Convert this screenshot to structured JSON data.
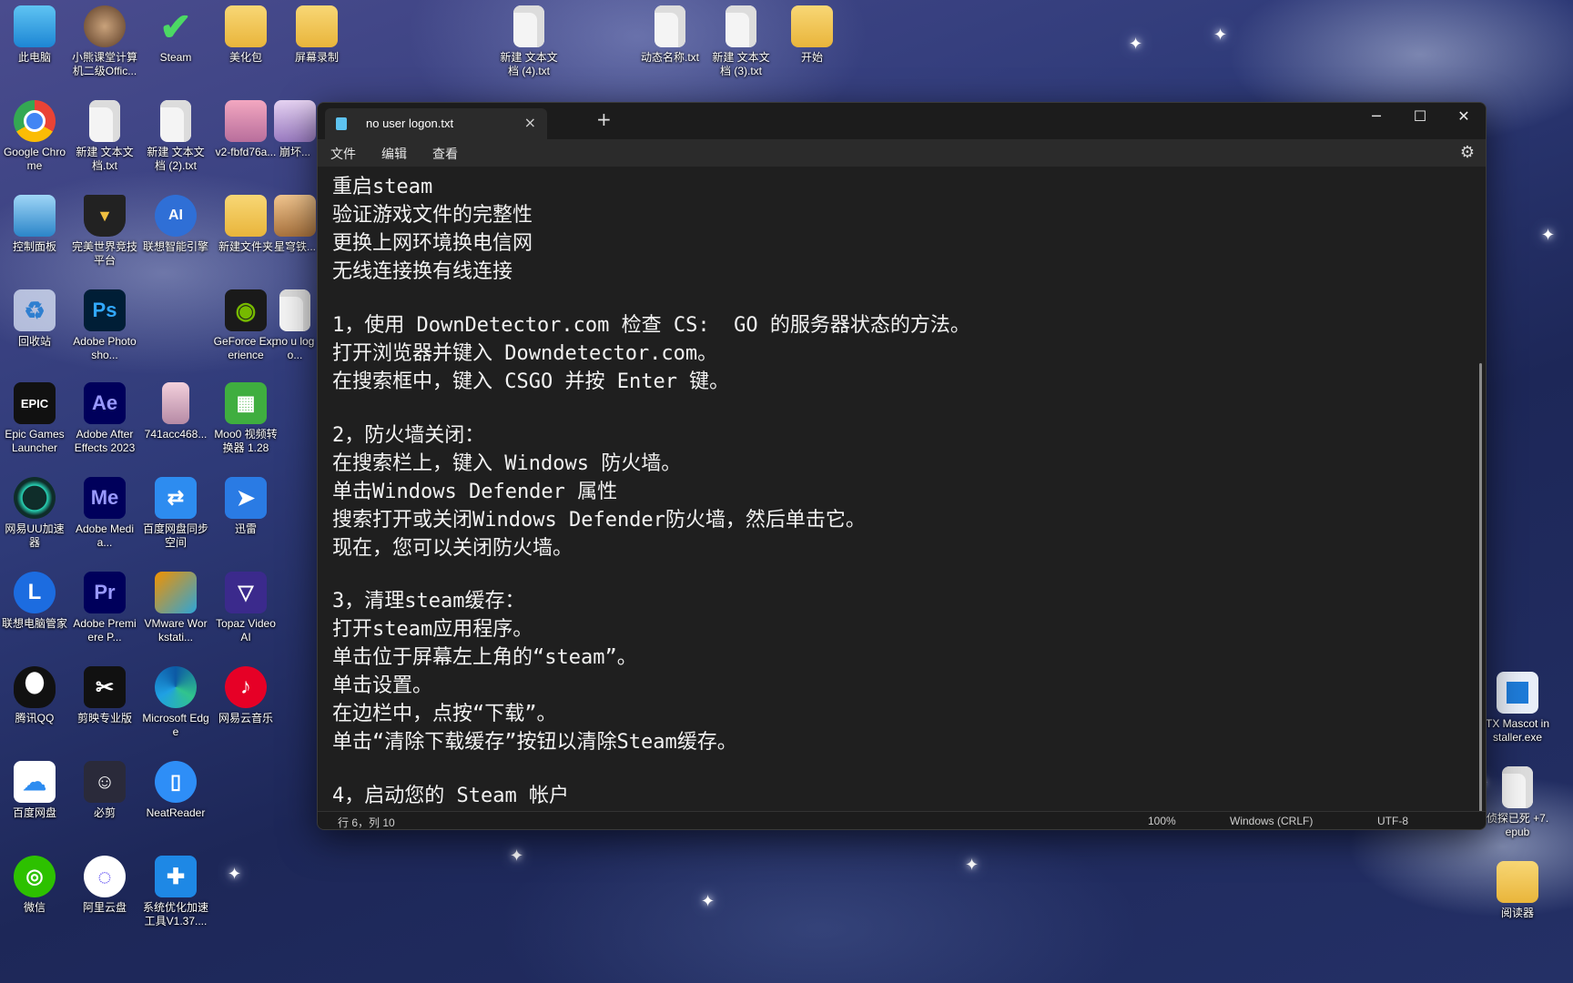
{
  "desktop_icons": [
    {
      "label": "此电脑"
    },
    {
      "label": "小熊课堂计算机二级Offic..."
    },
    {
      "label": "Steam"
    },
    {
      "label": "美化包"
    },
    {
      "label": "屏幕录制"
    },
    {
      "label": "新建 文本文档 (4).txt"
    },
    {
      "label": "动态名称.txt"
    },
    {
      "label": "新建 文本文档 (3).txt"
    },
    {
      "label": "开始"
    },
    {
      "label": "Google Chrome"
    },
    {
      "label": "新建 文本文档.txt"
    },
    {
      "label": "新建 文本文档 (2).txt"
    },
    {
      "label": "v2-fbfd76a..."
    },
    {
      "label": "崩坏..."
    },
    {
      "label": "控制面板"
    },
    {
      "label": "完美世界竞技平台"
    },
    {
      "label": "联想智能引擎"
    },
    {
      "label": "新建文件夹"
    },
    {
      "label": "星穹铁..."
    },
    {
      "label": "回收站"
    },
    {
      "label": "Adobe Photosho..."
    },
    {
      "label": "GeForce Experience"
    },
    {
      "label": "no u logo..."
    },
    {
      "label": "Epic Games Launcher"
    },
    {
      "label": "Adobe After Effects 2023"
    },
    {
      "label": "741acc468..."
    },
    {
      "label": "Moo0 视频转换器 1.28"
    },
    {
      "label": "网易UU加速器"
    },
    {
      "label": "Adobe Media..."
    },
    {
      "label": "百度网盘同步空间"
    },
    {
      "label": "迅雷"
    },
    {
      "label": "联想电脑管家"
    },
    {
      "label": "Adobe Premiere P..."
    },
    {
      "label": "VMware Workstati..."
    },
    {
      "label": "Topaz Video AI"
    },
    {
      "label": "腾讯QQ"
    },
    {
      "label": "剪映专业版"
    },
    {
      "label": "Microsoft Edge"
    },
    {
      "label": "网易云音乐"
    },
    {
      "label": "百度网盘"
    },
    {
      "label": "必剪"
    },
    {
      "label": "NeatReader"
    },
    {
      "label": "微信"
    },
    {
      "label": "阿里云盘"
    },
    {
      "label": "系统优化加速工具V1.37...."
    },
    {
      "label": "TX Mascot installer.exe"
    },
    {
      "label": "侦探已死 +7.epub"
    },
    {
      "label": "阅读器"
    }
  ],
  "icon_text": {
    "ps": "Ps",
    "ae": "Ae",
    "me": "Me",
    "pr": "Pr",
    "epic": "EPIC",
    "ai": "AI"
  },
  "notepad": {
    "tab_title": "no user logon.txt",
    "tab_close": "×",
    "new_tab": "+",
    "minimize": "─",
    "maximize": "☐",
    "close": "✕",
    "menu": [
      "文件",
      "编辑",
      "查看"
    ],
    "settings_icon": "⚙",
    "lines": [
      "重启steam",
      "验证游戏文件的完整性",
      "更换上网环境换电信网",
      "无线连接换有线连接",
      "",
      "1，使用 DownDetector.com 检查 CS:  GO 的服务器状态的方法。",
      "打开浏览器并键入 Downdetector.com。",
      "在搜索框中，键入 CSGO 并按 Enter 键。",
      "",
      "2，防火墙关闭：",
      "在搜索栏上，键入 Windows 防火墙。",
      "单击Windows Defender 属性",
      "搜索打开或关闭Windows Defender防火墙，然后单击它。",
      "现在，您可以关闭防火墙。",
      "",
      "3，清理steam缓存：",
      "打开steam应用程序。",
      "单击位于屏幕左上角的“steam”。",
      "单击设置。",
      "在边栏中，点按“下载”。",
      "单击“清除下载缓存”按钮以清除Steam缓存。",
      "",
      "4，启动您的 Steam 帐户"
    ],
    "status": {
      "position": "行 6，列 10",
      "zoom": "100%",
      "line_ending": "Windows (CRLF)",
      "encoding": "UTF-8"
    }
  }
}
